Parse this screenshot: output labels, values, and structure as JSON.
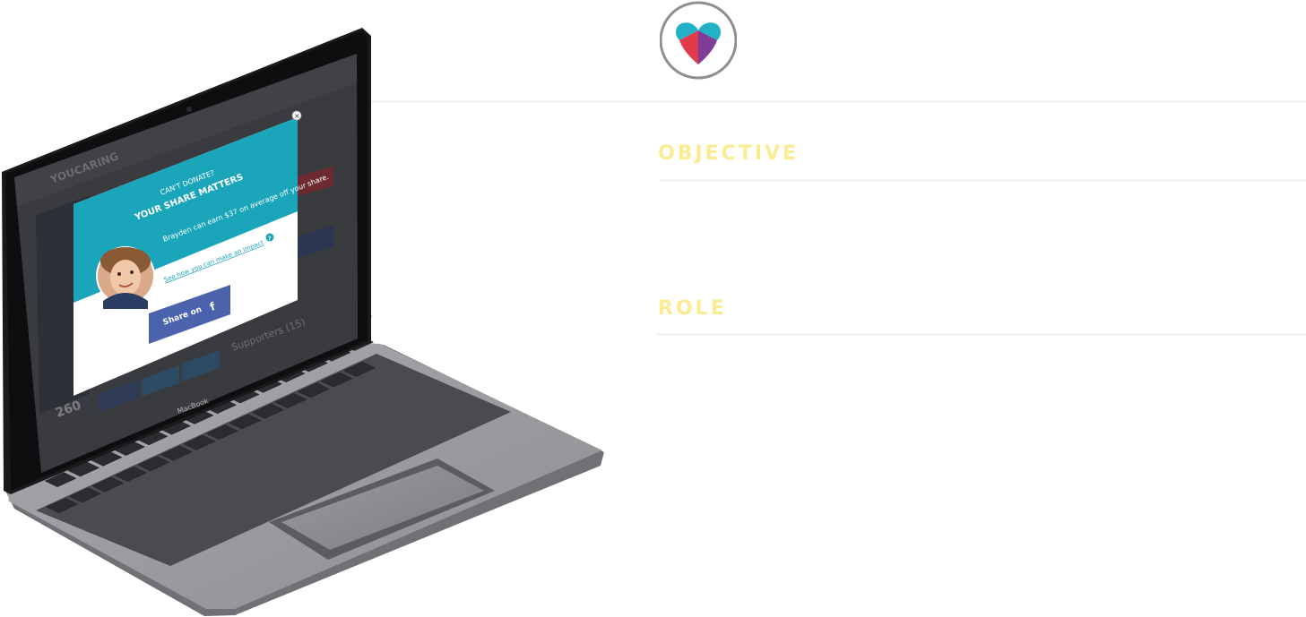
{
  "sections": {
    "objective_heading": "OBJECTIVE",
    "role_heading": "ROLE"
  },
  "logo": {
    "icon": "youcaring-heart-icon",
    "colors": [
      "#22b1c6",
      "#e33a4b",
      "#7f3d97"
    ]
  },
  "laptop": {
    "brand": "MacBook",
    "site_logo": "YOUCARING",
    "supporters_label": "Supporters (15)",
    "share_count": "260",
    "modal": {
      "eyebrow": "CAN'T DONATE?",
      "title": "YOUR SHARE MATTERS",
      "body": "Brayden can earn $37 on average off your share.",
      "link": "See how you can make an impact",
      "help_icon": "?",
      "share_label": "Share on",
      "share_icon": "f",
      "close_icon": "×"
    },
    "accent_colors": {
      "teal": "#1aa5ba",
      "facebook": "#4b63ad"
    }
  }
}
